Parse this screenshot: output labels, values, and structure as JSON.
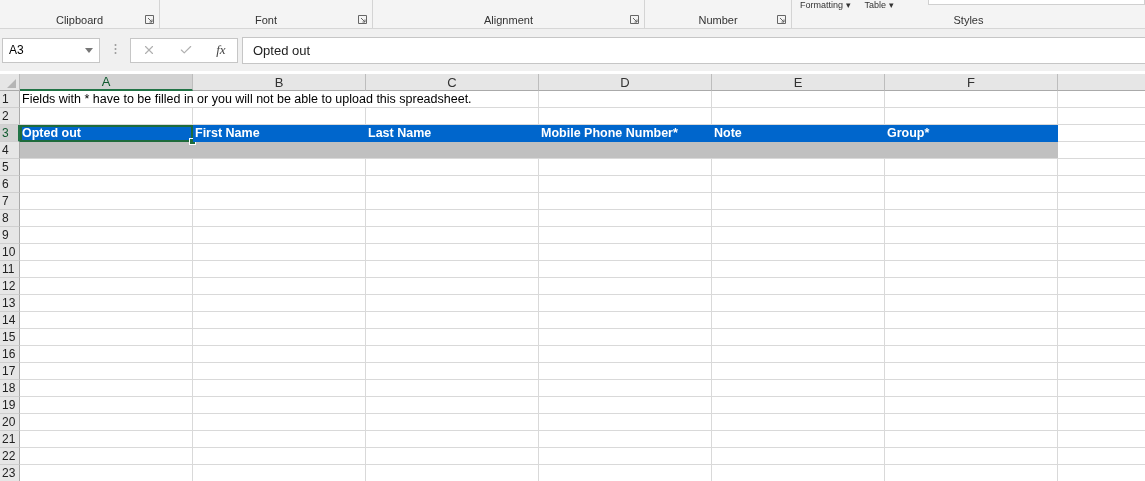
{
  "ribbon": {
    "style_buttons": [
      "Formatting ▾",
      "Table ▾"
    ],
    "groups": [
      {
        "label": "Clipboard",
        "launcher": true
      },
      {
        "label": "Font",
        "launcher": true
      },
      {
        "label": "Alignment",
        "launcher": true
      },
      {
        "label": "Number",
        "launcher": true
      },
      {
        "label": "Styles",
        "launcher": false
      }
    ]
  },
  "formula_bar": {
    "name_box": "A3",
    "function_label": "fx",
    "value": "Opted out"
  },
  "columns": [
    {
      "label": "A",
      "selected": true
    },
    {
      "label": "B",
      "selected": false
    },
    {
      "label": "C",
      "selected": false
    },
    {
      "label": "D",
      "selected": false
    },
    {
      "label": "E",
      "selected": false
    },
    {
      "label": "F",
      "selected": false
    }
  ],
  "rows": [
    {
      "number": "1",
      "kind": "note",
      "selected": false,
      "cells": [
        "Fields with * have to be filled in or you will not be able to upload this spreadsheet."
      ]
    },
    {
      "number": "2",
      "kind": "blank",
      "selected": false
    },
    {
      "number": "3",
      "kind": "header",
      "selected": true,
      "cells": [
        "Opted out",
        "First Name",
        "Last Name",
        "Mobile Phone Number*",
        "Note",
        "Group*"
      ]
    },
    {
      "number": "4",
      "kind": "band",
      "selected": false
    },
    {
      "number": "5",
      "kind": "blank",
      "selected": false
    },
    {
      "number": "6",
      "kind": "blank",
      "selected": false
    },
    {
      "number": "7",
      "kind": "blank",
      "selected": false
    },
    {
      "number": "8",
      "kind": "blank",
      "selected": false
    },
    {
      "number": "9",
      "kind": "blank",
      "selected": false
    },
    {
      "number": "10",
      "kind": "blank",
      "selected": false
    },
    {
      "number": "11",
      "kind": "blank",
      "selected": false
    },
    {
      "number": "12",
      "kind": "blank",
      "selected": false
    },
    {
      "number": "13",
      "kind": "blank",
      "selected": false
    },
    {
      "number": "14",
      "kind": "blank",
      "selected": false
    },
    {
      "number": "15",
      "kind": "blank",
      "selected": false
    },
    {
      "number": "16",
      "kind": "blank",
      "selected": false
    },
    {
      "number": "17",
      "kind": "blank",
      "selected": false
    },
    {
      "number": "18",
      "kind": "blank",
      "selected": false
    },
    {
      "number": "19",
      "kind": "blank",
      "selected": false
    },
    {
      "number": "20",
      "kind": "blank",
      "selected": false
    },
    {
      "number": "21",
      "kind": "blank",
      "selected": false
    },
    {
      "number": "22",
      "kind": "blank",
      "selected": false
    },
    {
      "number": "23",
      "kind": "blank",
      "selected": false
    }
  ]
}
